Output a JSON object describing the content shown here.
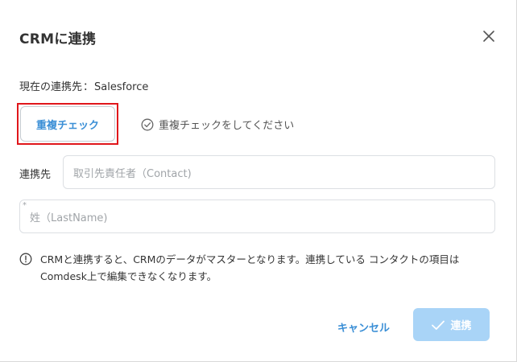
{
  "dialog": {
    "title": "CRMに連携",
    "current_label": "現在の連携先",
    "current_separator": "：",
    "current_value": "Salesforce"
  },
  "duplicate_check": {
    "button_label": "重複チェック",
    "hint": "重複チェックをしてください"
  },
  "form": {
    "link_label": "連携先",
    "contact_placeholder": "取引先責任者（Contact)",
    "required_mark": "*",
    "lastname_placeholder": "姓（LastName)"
  },
  "notice": {
    "text": "CRMと連携すると、CRMのデータがマスターとなります。連携している コンタクトの項目はComdesk上で編集できなくなります。"
  },
  "footer": {
    "cancel_label": "キャンセル",
    "confirm_label": "連携"
  },
  "colors": {
    "accent": "#3b8fd6",
    "confirm_disabled": "#a9d4f7",
    "highlight": "#e0161b"
  },
  "icons": {
    "close": "close-icon",
    "check_circle": "check-circle-icon",
    "info": "info-icon",
    "check": "check-icon"
  }
}
